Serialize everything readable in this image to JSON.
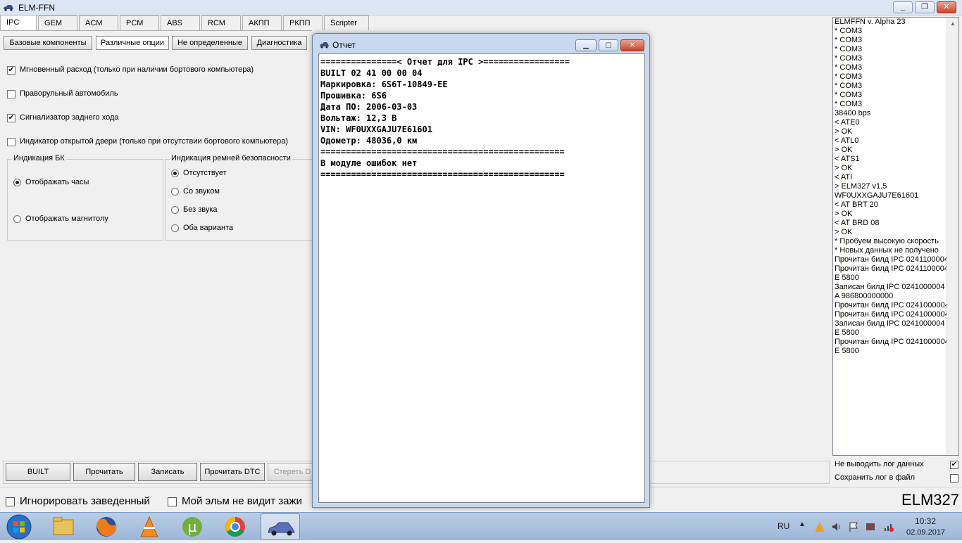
{
  "window": {
    "title": "ELM-FFN",
    "controls": [
      "_",
      "❐",
      "✕"
    ]
  },
  "tabs": [
    "IPC",
    "GEM",
    "ACM",
    "PCM",
    "ABS",
    "RCM",
    "АКПП",
    "РКПП",
    "Scripter"
  ],
  "subtabs": [
    "Базовые компоненты",
    "Различные опции",
    "Не определенные",
    "Диагностика"
  ],
  "options": [
    {
      "label": "Мгновенный расход (только при наличии бортового компьютера)",
      "checked": true,
      "mark": "✔"
    },
    {
      "label": "Праворульный автомобиль",
      "checked": false,
      "mark": ""
    },
    {
      "label": "Сигнализатор заднего хода",
      "checked": true,
      "mark": "✔"
    },
    {
      "label": "Индикатор открытой двери (только при отсутствии бортового компьютера)",
      "checked": false,
      "mark": ""
    }
  ],
  "group_bk": {
    "title": "Индикация БК",
    "options": [
      "Отображать часы",
      "Отображать магнитолу"
    ],
    "selected": 0
  },
  "group_belts": {
    "title": "Индикация ремней безопасности",
    "options": [
      "Отсутствует",
      "Со звуком",
      "Без звука",
      "Оба варианта"
    ],
    "selected": 0
  },
  "buttons": [
    "BUILT",
    "Прочитать",
    "Записать",
    "Прочитать DTC",
    "Стереть D"
  ],
  "status": {
    "ignore_running": "Игнорировать заведенный",
    "no_ignition": "Мой эльм не видит зажи",
    "adapter": "ELM327"
  },
  "log": {
    "lines": [
      "ELMFFN v. Alpha 23",
      "* COM3",
      "* COM3",
      "* COM3",
      "* COM3",
      "* COM3",
      "* COM3",
      "* COM3",
      "* COM3",
      "* COM3",
      "38400 bps",
      "< ATE0",
      "> OK",
      "< ATL0",
      "> OK",
      "< ATS1",
      "> OK",
      "< ATI",
      "> ELM327 v1.5",
      "WF0UXXGAJU7E61601",
      "< AT BRT 20",
      "> OK",
      "< AT BRD 08",
      "> OK",
      "* Пробуем высокую скорость",
      "* Новых данных не получено",
      "Прочитан билд IPC 0241100004",
      "Прочитан билд IPC 0241100004",
      "E 5800",
      "Записан билд IPC 0241000004",
      "A 986800000000",
      "Прочитан билд IPC 0241000004",
      "Прочитан билд IPC 0241000004",
      "Записан билд IPC 0241000004",
      "E 5800",
      "Прочитан билд IPC 0241000004",
      "E 5800"
    ],
    "no_log": "Не выводить лог данных",
    "no_log_mark": "✔",
    "save_log": "Сохранить лог в файл",
    "save_log_mark": ""
  },
  "dialog": {
    "title": "Отчет",
    "lines": [
      "===============< Отчет для IPC >=================",
      "BUILT 02 41 00 00 04",
      "Маркировка: 6S6T-10849-EE",
      "Прошивка: 6S6",
      "Дата ПО: 2006-03-03",
      "Вольтаж: 12,3 В",
      "VIN: WF0UXXGAJU7E61601",
      "Одометр: 48036,0 км",
      "================================================",
      "В модуле ошибок нет",
      "================================================"
    ]
  },
  "taskbar": {
    "lang": "RU",
    "time": "10:32",
    "date": "02.09.2017"
  }
}
